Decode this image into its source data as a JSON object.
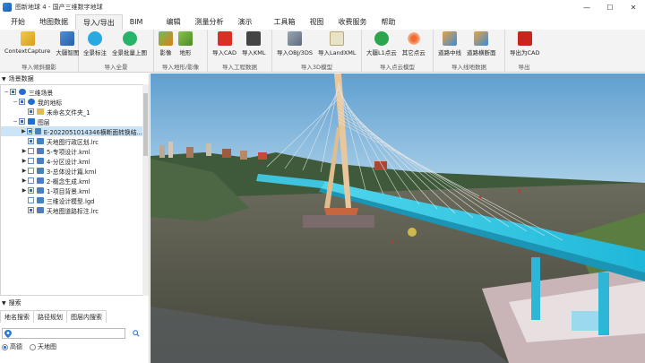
{
  "window": {
    "title": "图新地球 4 - 国产三维数字地球",
    "controls": [
      "—",
      "☐",
      "✕"
    ]
  },
  "menu": {
    "tabs": [
      "开始",
      "地图数据",
      "导入/导出",
      "BIM",
      "编辑",
      "测量分析",
      "演示",
      "工具箱",
      "视图",
      "收费服务",
      "帮助"
    ],
    "active_index": 2
  },
  "ribbon": {
    "groups": [
      {
        "label": "导入倾斜摄影",
        "buttons": [
          "ContextCapture",
          "大疆智图"
        ]
      },
      {
        "label": "导入全景",
        "buttons": [
          "全景标注",
          "全景批量上图"
        ]
      },
      {
        "label": "导入地形/影像",
        "buttons": [
          "影像",
          "地形"
        ]
      },
      {
        "label": "导入工程数据",
        "buttons": [
          "导入CAD",
          "导入KML"
        ]
      },
      {
        "label": "导入3D模型",
        "buttons": [
          "导入OBJ/3DS",
          "导入LandXML"
        ]
      },
      {
        "label": "导入点云模型",
        "buttons": [
          "大疆L1点云",
          "其它点云"
        ]
      },
      {
        "label": "导入线地数据",
        "buttons": [
          "道路中线",
          "道路横断面"
        ]
      },
      {
        "label": "导出",
        "buttons": [
          "导出为CAD"
        ]
      }
    ]
  },
  "colors": {
    "accent": "#1e6fd0",
    "selection": "#cce4f7",
    "river": "#4d4f45",
    "sky": "#7fb6dd"
  },
  "panel": {
    "title": "场景数据",
    "tree": [
      {
        "label": "三维场景",
        "level": 0,
        "expand": "−",
        "checked": true,
        "icon": "globe-icon"
      },
      {
        "label": "我的地标",
        "level": 1,
        "expand": "−",
        "checked": true,
        "icon": "pin-icon"
      },
      {
        "label": "未命名文件夹_1",
        "level": 2,
        "expand": "",
        "checked": true,
        "icon": "folder-icon"
      },
      {
        "label": "图层",
        "level": 1,
        "expand": "−",
        "checked": true,
        "icon": "layers-icon"
      },
      {
        "label": "E-2022051014346横断面转换结...",
        "level": 2,
        "expand": "▶",
        "checked": true,
        "icon": "layer-icon",
        "selected": true
      },
      {
        "label": "天地图行政区划.lrc",
        "level": 2,
        "expand": "",
        "checked": true,
        "icon": "layer-icon"
      },
      {
        "label": "5-专项设计.kml",
        "level": 2,
        "expand": "▶",
        "checked": false,
        "icon": "layer-icon"
      },
      {
        "label": "4-分区设计.kml",
        "level": 2,
        "expand": "▶",
        "checked": false,
        "icon": "layer-icon"
      },
      {
        "label": "3-总体设计篇.kml",
        "level": 2,
        "expand": "▶",
        "checked": false,
        "icon": "layer-icon"
      },
      {
        "label": "2-概念生成.kml",
        "level": 2,
        "expand": "▶",
        "checked": false,
        "icon": "layer-icon"
      },
      {
        "label": "1-项目背景.kml",
        "level": 2,
        "expand": "▶",
        "checked": true,
        "icon": "layer-icon"
      },
      {
        "label": "三维设计模型.lgd",
        "level": 2,
        "expand": "",
        "checked": false,
        "icon": "layer-icon"
      },
      {
        "label": "天地图道路标注.lrc",
        "level": 2,
        "expand": "",
        "checked": true,
        "icon": "layer-icon"
      }
    ]
  },
  "search": {
    "title": "搜索",
    "tabs": [
      "地名搜索",
      "路径规划",
      "图层内搜索"
    ],
    "input_value": "",
    "options": [
      {
        "label": "高德",
        "selected": true
      },
      {
        "label": "天地图",
        "selected": false
      }
    ]
  }
}
